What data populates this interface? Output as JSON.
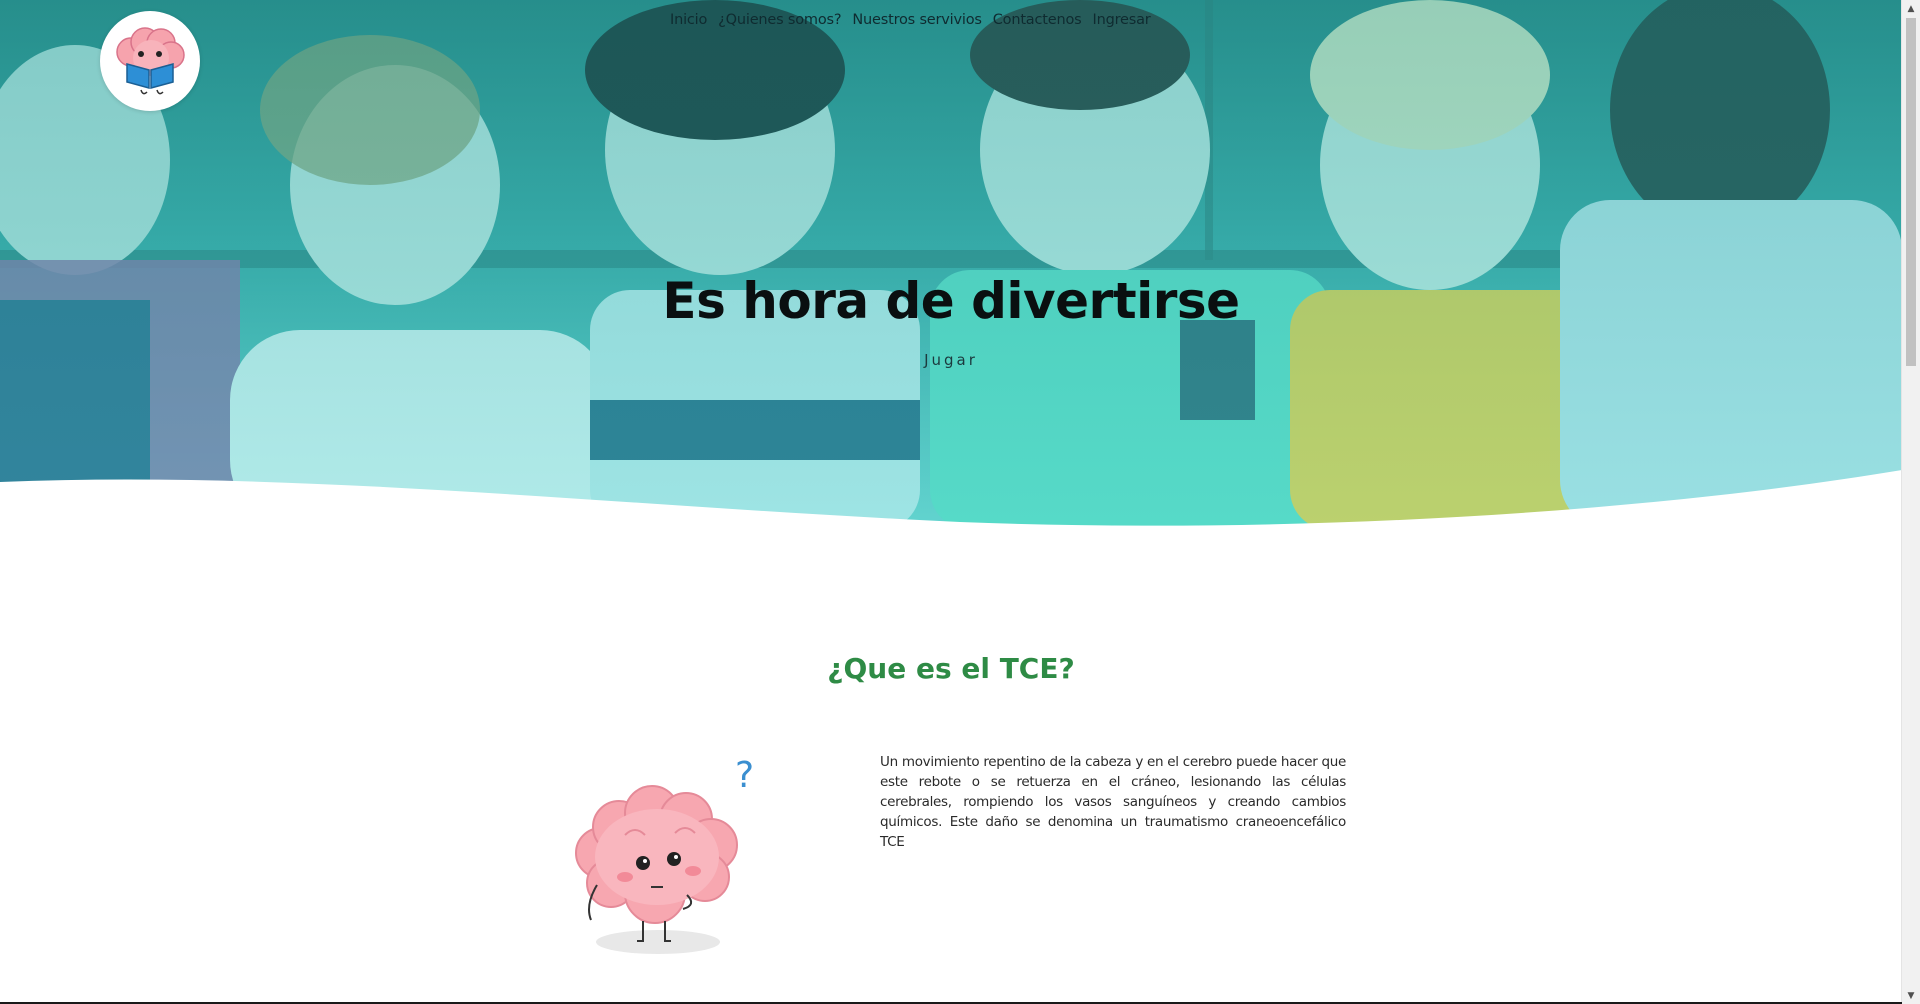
{
  "nav": {
    "items": [
      {
        "label": "Inicio"
      },
      {
        "label": "¿Quienes somos?"
      },
      {
        "label": "Nuestros servivios"
      },
      {
        "label": "Contactenos"
      },
      {
        "label": "Ingresar"
      }
    ]
  },
  "logo": {
    "icon": "brain-reading-book-icon"
  },
  "hero": {
    "title": "Es hora de divertirse",
    "button_label": "Jugar",
    "overlay_color": "#3fc7c3"
  },
  "section": {
    "title": "¿Que es el TCE?",
    "text": "Un movimiento repentino de la cabeza y en el cerebro puede hacer que este rebote o se retuerza en el cráneo, lesionando las células cerebrales, rompiendo los vasos sanguíneos y creando cambios químicos. Este daño se denomina un traumatismo craneoencefálico TCE",
    "title_color": "#2e8b45",
    "illustration": "confused-brain-icon"
  },
  "scrollbar": {
    "up_glyph": "▲",
    "down_glyph": "▼"
  }
}
